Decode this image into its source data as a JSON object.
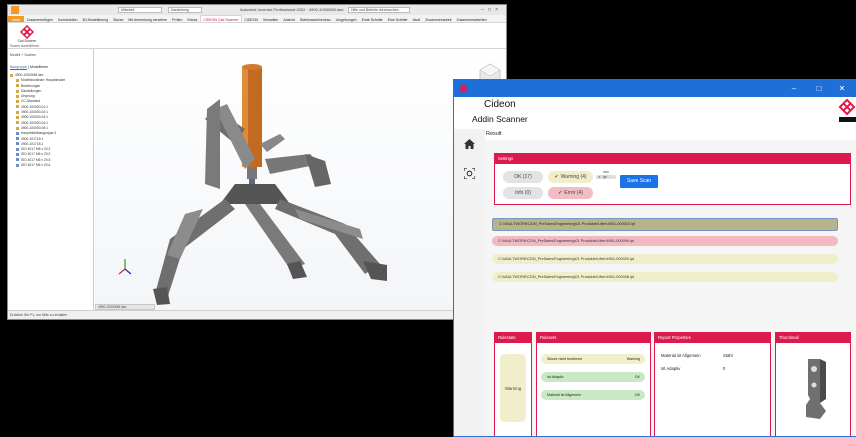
{
  "inventor": {
    "search_placeholder": "Mitarbeit",
    "quick_access": "Darstellung",
    "app_title": "Autodesk Inventor Professional 2022 · 4900-100000M.iam",
    "search_help": "Hilfe und Befehle durchsuchen",
    "ribbon_tabs": [
      "Datei",
      "Zusammenfügen",
      "Konstruktion",
      "3D-Modellierung",
      "Skizze",
      "Mit Anmerkung versehen",
      "Prüfen",
      "Extras",
      "CIDEON Cad Scanner",
      "CIDEON",
      "Verwalten",
      "Ansicht",
      "Stahlmaschinenbau",
      "Umgebungen",
      "Erste Schritte",
      "Eine Schritte",
      "Vault",
      "Zusammenarbeit",
      "Zusammenarbeiten"
    ],
    "active_tab": "CIDEON Cad Scanner",
    "scan_button_label": "Cad Scanner",
    "ribbon_group": "Scans durchführen",
    "browser_header": "Modell",
    "browser_sub": "Suchen",
    "browser_tabs": {
      "active": "Baugruppe",
      "other": "Modellieren"
    },
    "tree_items": [
      "4900-100000M.iam",
      "Modellzustände: Hauptansicht",
      "Beziehungen",
      "Darstellungen",
      "Ursprung",
      "CC-Standard",
      "4900-100000-01:1",
      "4900-100000-02:1",
      "4900-100000-03:1",
      "4900-100000-04:1",
      "4900-100000-05:1",
      "Hauptmittelbaugruppe:1",
      "4900-101716:1",
      "4900-101718:1",
      "ISO 4017 M6 x 20:1",
      "ISO 4017 M6 x 20:2",
      "ISO 4017 M6 x 20:3",
      "ISO 4017 M6 x 20:4"
    ],
    "doc_tab": "4900-100000M.iam",
    "status_text": "Drücken Sie F1, um Hilfe zu erhalten"
  },
  "cideon": {
    "title": "Cideon",
    "subtitle": "Addin Scanner",
    "tab": "Result",
    "settings": {
      "header": "Settings",
      "ok": "OK (17)",
      "warning": "Warning (4)",
      "info": "Info (0)",
      "error": "Error (4)",
      "toggle_a": "iam",
      "toggle_b": "ipt",
      "save": "Save Scan"
    },
    "files": [
      {
        "path": "C:\\VAULTWORK\\CDN_PreSales\\Engineering\\01 Produkte\\Lifter\\4901-000010.ipt",
        "state": "selected"
      },
      {
        "path": "C:\\VAULTWORK\\CDN_PreSales\\Engineering\\01 Produkte\\Lifter\\4901-000009.ipt",
        "state": "error"
      },
      {
        "path": "C:\\VAULTWORK\\CDN_PreSales\\Engineering\\01 Produkte\\Lifter\\4901-000020.ipt",
        "state": "warning"
      },
      {
        "path": "C:\\VAULTWORK\\CDN_PreSales\\Engineering\\01 Produkte\\Lifter\\4901-000008.ipt",
        "state": "warning"
      }
    ],
    "rulestate": {
      "header": "Rulestate",
      "value": "Warning"
    },
    "rulesets": {
      "header": "Rulesets",
      "items": [
        {
          "name": "Skizze nicht bestimmt",
          "status": "Warning"
        },
        {
          "name": "Ist Adaptiv",
          "status": "OK"
        },
        {
          "name": "Material ist Allgemein",
          "status": "OK"
        }
      ]
    },
    "report": {
      "header": "Report Properties",
      "rows": [
        {
          "key": "Material ist Allgemein",
          "value": "Stahl"
        },
        {
          "key": "Ist Adaptiv",
          "value": "0"
        }
      ]
    },
    "thumbnail": {
      "header": "Thumbnail"
    }
  },
  "colors": {
    "accent": "#dc1a4e",
    "titlebar": "#1f6fd8",
    "save": "#1a73e8"
  }
}
